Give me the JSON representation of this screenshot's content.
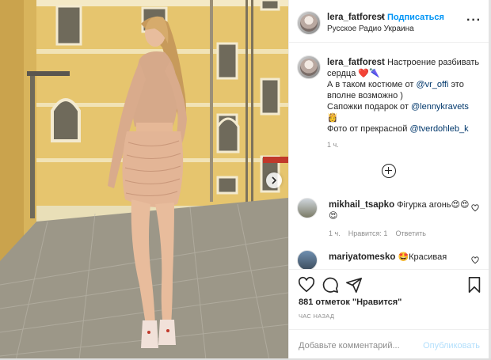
{
  "post": {
    "header": {
      "username": "lera_fatforest",
      "dot": "•",
      "follow_label": "Подписаться",
      "location": "Русское Радио Украина",
      "more_label": "···"
    },
    "caption": {
      "username": "lera_fatforest",
      "line1": "Настроение разбивать сердца",
      "emoji1": "❤️🌂",
      "line2a": "А в таком костюме от",
      "mention1": "@vr_offi",
      "line2b": "это вполне возможно )",
      "line3": "Сапожки подарок от",
      "mention2": "@lennykravets",
      "emoji2": "👸",
      "line4": "Фото от прекрасной",
      "mention3": "@tverdohleb_k",
      "time": "1 ч."
    },
    "comments": [
      {
        "username": "mikhail_tsapko",
        "text": "Фігурка агонь",
        "emoji": "😍😍😍",
        "time": "1 ч.",
        "likes": "Нравится: 1",
        "reply": "Ответить"
      },
      {
        "username": "mariyatomesko",
        "emoji": "🤩",
        "text": "Красивая"
      }
    ],
    "likes_text": "881 отметок \"Нравится\"",
    "time_ago": "ЧАС НАЗАД",
    "add_comment": {
      "placeholder": "Добавьте комментарий...",
      "publish_label": "Опубликовать"
    },
    "icons": {
      "like": "heart-icon",
      "comment": "comment-icon",
      "share": "share-icon",
      "save": "bookmark-icon",
      "next": "chevron-right-icon",
      "load_more": "plus-circle-icon"
    },
    "colors": {
      "link_blue": "#0095f6",
      "mention": "#00376b",
      "muted": "#8e8e8e",
      "publish_disabled": "#b2dffc"
    }
  }
}
